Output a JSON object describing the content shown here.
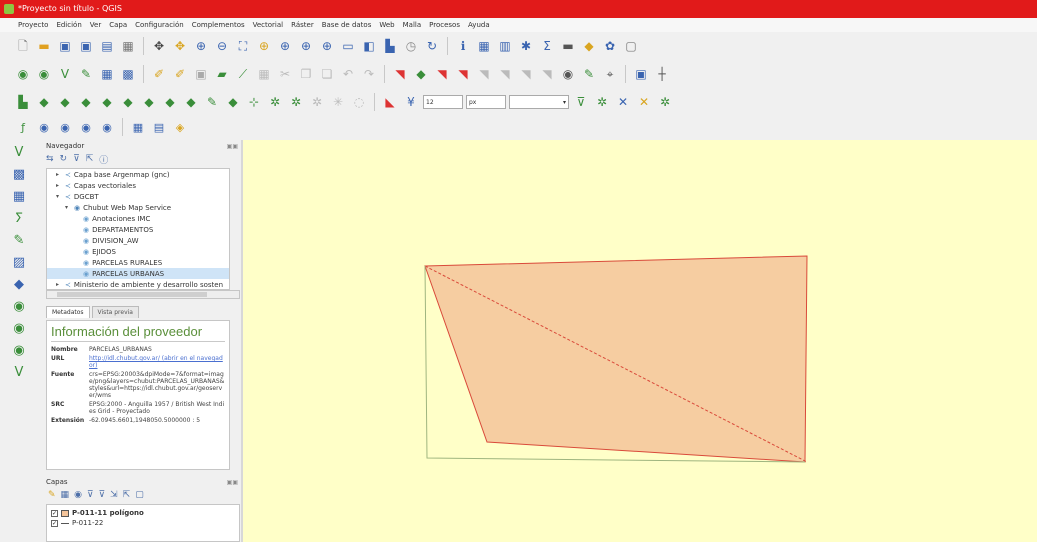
{
  "window": {
    "title": "*Proyecto sin título - QGIS"
  },
  "menu": [
    "Proyecto",
    "Edición",
    "Ver",
    "Capa",
    "Configuración",
    "Complementos",
    "Vectorial",
    "Ráster",
    "Base de datos",
    "Web",
    "Malla",
    "Procesos",
    "Ayuda"
  ],
  "toolbar1": {
    "icons": [
      "new-project-icon",
      "open-project-icon",
      "save-project-icon",
      "save-as-icon",
      "print-layout-icon",
      "layout-manager-icon",
      "style-manager-icon",
      "pan-icon",
      "pan-to-selection-icon",
      "zoom-in-icon",
      "zoom-out-icon",
      "zoom-full-icon",
      "zoom-to-selection-icon",
      "zoom-to-layer-icon",
      "zoom-last-icon",
      "zoom-next-icon",
      "new-map-view-icon",
      "bookmark-icon",
      "temporal-controller-icon",
      "refresh-icon",
      "identify-icon",
      "attribute-table-icon",
      "field-calculator-icon",
      "statistics-icon",
      "sum-icon",
      "measure-icon",
      "annotation-icon",
      "tips-icon",
      "locator-icon"
    ]
  },
  "toolbar2": {
    "icons": [
      "digitize-icon"
    ]
  },
  "toolbar3": {
    "font_size": "12",
    "unit": "px"
  },
  "browser": {
    "title": "Navegador",
    "items": [
      {
        "label": "Capa base Argenmap (gnc)",
        "indent": 1,
        "expander": "▸",
        "icon": "wms-connection-icon"
      },
      {
        "label": "Capas vectoriales",
        "indent": 1,
        "expander": "▸",
        "icon": "wms-connection-icon"
      },
      {
        "label": "DGCBT",
        "indent": 1,
        "expander": "▾",
        "icon": "wms-connection-icon"
      },
      {
        "label": "Chubut Web Map Service",
        "indent": 2,
        "expander": "▾",
        "icon": "wms-service-icon"
      },
      {
        "label": "Anotaciones IMC",
        "indent": 3,
        "expander": "",
        "icon": "wms-layer-icon"
      },
      {
        "label": "DEPARTAMENTOS",
        "indent": 3,
        "expander": "",
        "icon": "wms-layer-icon"
      },
      {
        "label": "DIVISION_AW",
        "indent": 3,
        "expander": "",
        "icon": "wms-layer-icon"
      },
      {
        "label": "EJIDOS",
        "indent": 3,
        "expander": "",
        "icon": "wms-layer-icon"
      },
      {
        "label": "PARCELAS RURALES",
        "indent": 3,
        "expander": "",
        "icon": "wms-layer-icon"
      },
      {
        "label": "PARCELAS URBANAS",
        "indent": 3,
        "expander": "",
        "icon": "wms-layer-icon",
        "selected": true
      },
      {
        "label": "Ministerio de ambiente y desarrollo sosten",
        "indent": 1,
        "expander": "▸",
        "icon": "wms-connection-icon"
      }
    ]
  },
  "metadata": {
    "tabs": [
      "Metadatos",
      "Vista previa"
    ],
    "heading": "Información del proveedor",
    "rows": [
      {
        "key": "Nombre",
        "value": "PARCELAS_URBANAS"
      },
      {
        "key": "URL",
        "value": "http://idl.chubut.gov.ar/ (abrir en el navegador)",
        "link": true
      },
      {
        "key": "Fuente",
        "value": "crs=EPSG:20003&dpiMode=7&format=image/png&layers=chubut:PARCELAS_URBANAS&styles&url=https://idl.chubut.gov.ar/geoserver/wms"
      },
      {
        "key": "SRC",
        "value": "EPSG:2000 - Anguilla 1957 / British West Indies Grid - Proyectado"
      },
      {
        "key": "Extensión",
        "value": "-62.0945.6601,1948050.5000000 : 5"
      }
    ]
  },
  "layers": {
    "title": "Capas",
    "items": [
      {
        "label": "P-011-11 polígono",
        "checked": true,
        "symbol": "fill",
        "selected": true
      },
      {
        "label": "P-011-22",
        "checked": true,
        "symbol": "line",
        "selected": false
      }
    ]
  },
  "colors": {
    "titlebar": "#e11a1a",
    "canvas": "#ffffc8",
    "polygon_fill": "#f4c49a",
    "polygon_stroke": "#d94a3a",
    "line": "#9fb57f"
  }
}
